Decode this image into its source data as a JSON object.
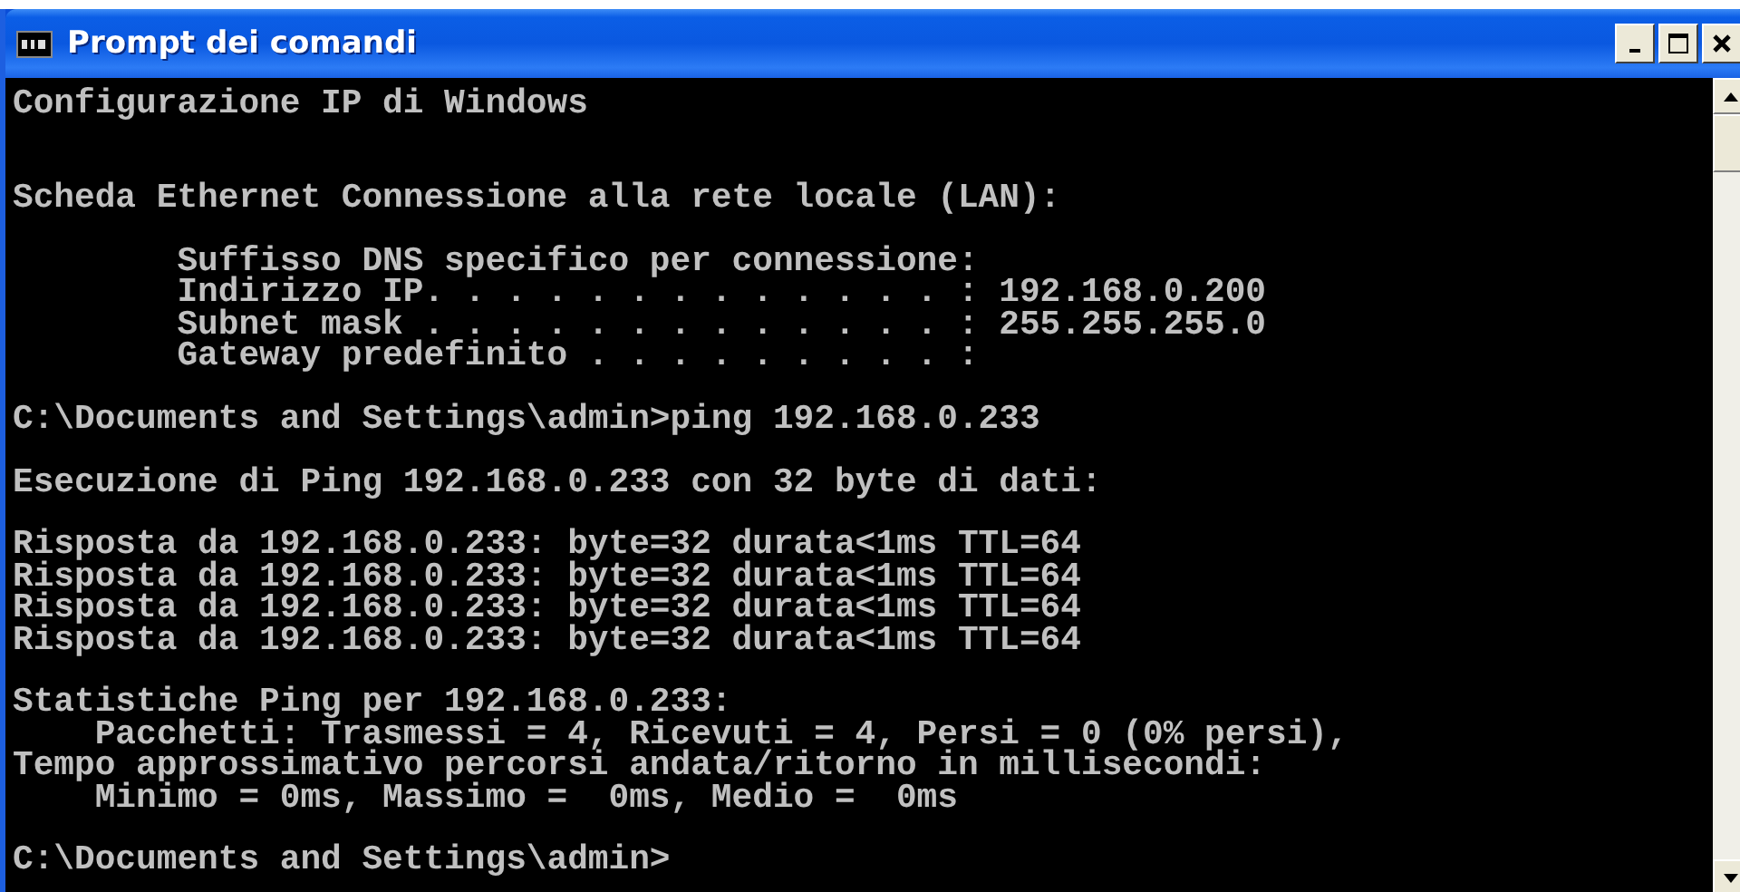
{
  "window": {
    "title": "Prompt dei comandi"
  },
  "console": {
    "blocks": [
      {
        "kind": "heading",
        "lines": [
          "Configurazione IP di Windows"
        ]
      },
      {
        "kind": "output",
        "lines": [
          "Scheda Ethernet Connessione alla rete locale (LAN):"
        ]
      },
      {
        "kind": "output",
        "lines": [
          "        Suffisso DNS specifico per connessione:",
          "        Indirizzo IP. . . . . . . . . . . . . : 192.168.0.200",
          "        Subnet mask . . . . . . . . . . . . . : 255.255.255.0",
          "        Gateway predefinito . . . . . . . . . :"
        ]
      },
      {
        "kind": "output",
        "lines": [
          "C:\\Documents and Settings\\admin>ping 192.168.0.233"
        ]
      },
      {
        "kind": "output",
        "lines": [
          "Esecuzione di Ping 192.168.0.233 con 32 byte di dati:"
        ]
      },
      {
        "kind": "output",
        "lines": [
          "Risposta da 192.168.0.233: byte=32 durata<1ms TTL=64",
          "Risposta da 192.168.0.233: byte=32 durata<1ms TTL=64",
          "Risposta da 192.168.0.233: byte=32 durata<1ms TTL=64",
          "Risposta da 192.168.0.233: byte=32 durata<1ms TTL=64"
        ]
      },
      {
        "kind": "output",
        "lines": [
          "Statistiche Ping per 192.168.0.233:",
          "    Pacchetti: Trasmessi = 4, Ricevuti = 4, Persi = 0 (0% persi),",
          "Tempo approssimativo percorsi andata/ritorno in millisecondi:",
          "    Minimo = 0ms, Massimo =  0ms, Medio =  0ms"
        ]
      },
      {
        "kind": "output",
        "lines": [
          "C:\\Documents and Settings\\admin>"
        ]
      }
    ]
  }
}
